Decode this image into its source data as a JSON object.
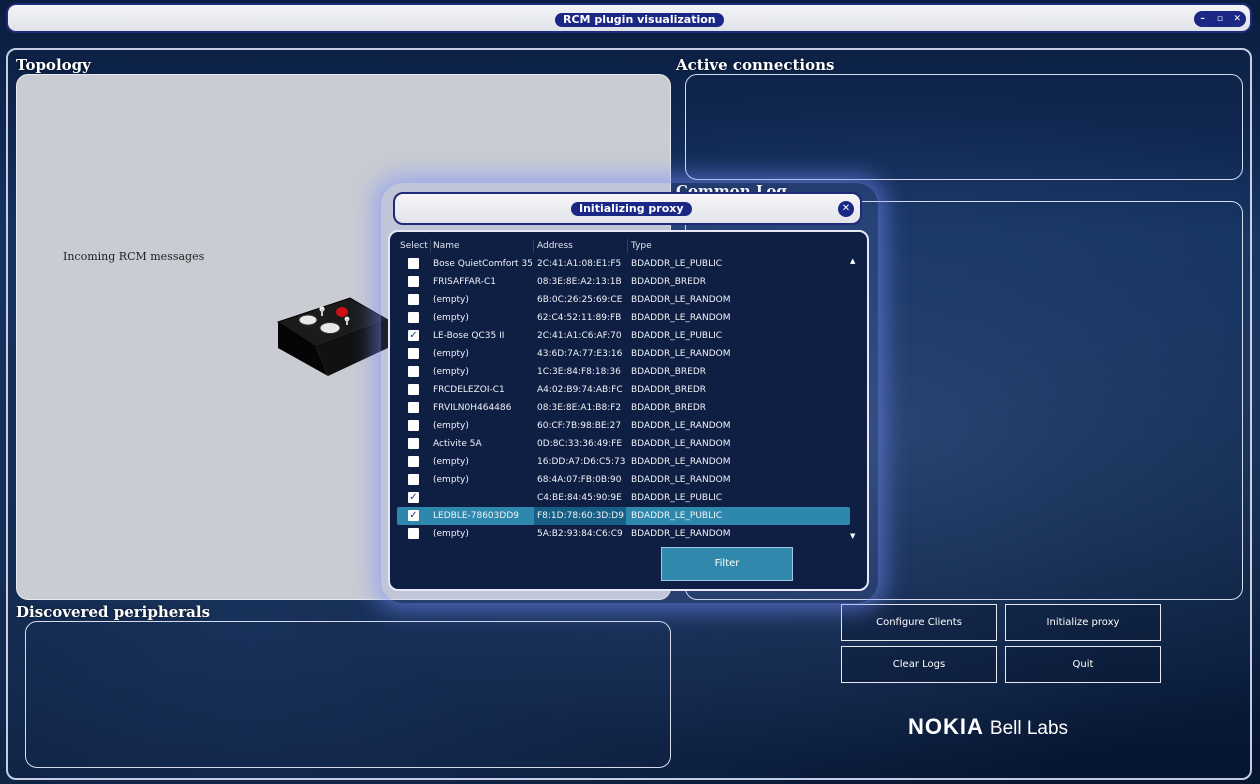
{
  "window": {
    "title": "RCM plugin visualization",
    "controls": {
      "minimize": "–",
      "maximize": "▫",
      "close": "✕"
    }
  },
  "sections": {
    "topology": "Topology",
    "active_connections": "Active connections",
    "common_log": "Common Log",
    "discovered_peripherals": "Discovered peripherals"
  },
  "topology": {
    "incoming_label": "Incoming RCM messages"
  },
  "buttons": {
    "configure_clients": "Configure Clients",
    "initialize_proxy": "Initialize proxy",
    "clear_logs": "Clear Logs",
    "quit": "Quit"
  },
  "logo": {
    "brand": "NOKIA",
    "suffix": "Bell Labs"
  },
  "dialog": {
    "title": "Initializing proxy",
    "close": "✕",
    "columns": {
      "select": "Select",
      "name": "Name",
      "address": "Address",
      "type": "Type"
    },
    "rows": [
      {
        "checked": false,
        "name": "Bose QuietComfort 35",
        "address": "2C:41:A1:08:E1:F5",
        "type": "BDADDR_LE_PUBLIC"
      },
      {
        "checked": false,
        "name": "FRISAFFAR-C1",
        "address": "08:3E:8E:A2:13:1B",
        "type": "BDADDR_BREDR"
      },
      {
        "checked": false,
        "name": "(empty)",
        "address": "6B:0C:26:25:69:CE",
        "type": "BDADDR_LE_RANDOM"
      },
      {
        "checked": false,
        "name": "(empty)",
        "address": "62:C4:52:11:89:FB",
        "type": "BDADDR_LE_RANDOM"
      },
      {
        "checked": true,
        "name": "LE-Bose QC35 II",
        "address": "2C:41:A1:C6:AF:70",
        "type": "BDADDR_LE_PUBLIC"
      },
      {
        "checked": false,
        "name": "(empty)",
        "address": "43:6D:7A:77:E3:16",
        "type": "BDADDR_LE_RANDOM"
      },
      {
        "checked": false,
        "name": "(empty)",
        "address": "1C:3E:84:F8:18:36",
        "type": "BDADDR_BREDR"
      },
      {
        "checked": false,
        "name": "FRCDELEZOI-C1",
        "address": "A4:02:B9:74:AB:FC",
        "type": "BDADDR_BREDR"
      },
      {
        "checked": false,
        "name": "FRVILN0H464486",
        "address": "08:3E:8E:A1:B8:F2",
        "type": "BDADDR_BREDR"
      },
      {
        "checked": false,
        "name": "(empty)",
        "address": "60:CF:7B:98:BE:27",
        "type": "BDADDR_LE_RANDOM"
      },
      {
        "checked": false,
        "name": "Activite 5A",
        "address": "0D:8C:33:36:49:FE",
        "type": "BDADDR_LE_RANDOM"
      },
      {
        "checked": false,
        "name": "(empty)",
        "address": "16:DD:A7:D6:C5:73",
        "type": "BDADDR_LE_RANDOM"
      },
      {
        "checked": false,
        "name": "(empty)",
        "address": "68:4A:07:FB:0B:90",
        "type": "BDADDR_LE_RANDOM"
      },
      {
        "checked": true,
        "name": "",
        "address": "C4:BE:84:45:90:9E",
        "type": "BDADDR_LE_PUBLIC"
      },
      {
        "checked": true,
        "selected": true,
        "name": "LEDBLE-78603DD9",
        "address": "F8:1D:78:60:3D:D9",
        "type": "BDADDR_LE_PUBLIC"
      },
      {
        "checked": false,
        "name": "(empty)",
        "address": "5A:B2:93:84:C6:C9",
        "type": "BDADDR_LE_RANDOM"
      }
    ],
    "filter_label": "Filter",
    "scroll_up": "▲",
    "scroll_down": "▼"
  }
}
